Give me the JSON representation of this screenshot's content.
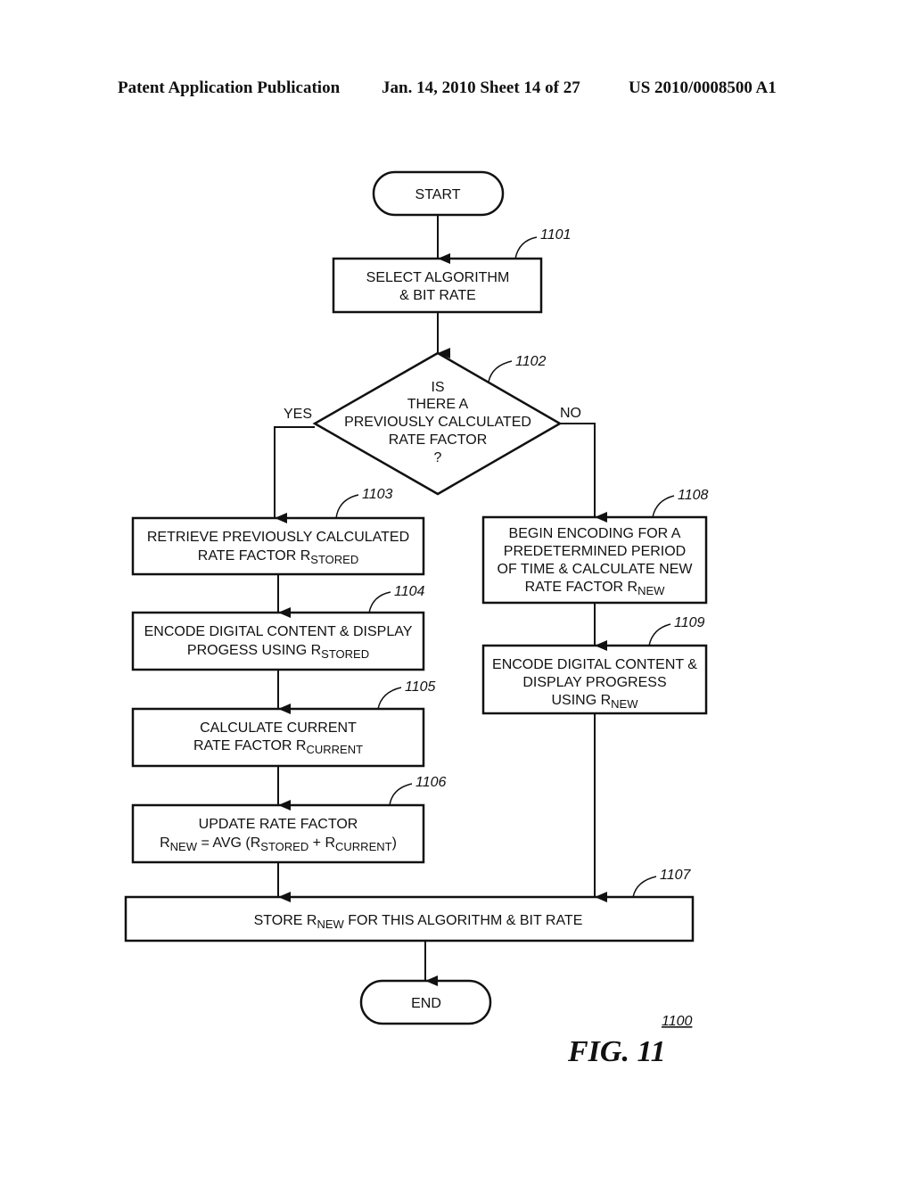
{
  "header": {
    "left": "Patent Application Publication",
    "middle": "Jan. 14, 2010  Sheet 14 of 27",
    "right": "US 2010/0008500 A1"
  },
  "figure": {
    "label": "FIG. 11",
    "ref": "1100"
  },
  "nodes": {
    "start": {
      "text": "START"
    },
    "n1101": {
      "ref": "1101",
      "lines": [
        "SELECT ALGORITHM",
        "& BIT RATE"
      ]
    },
    "n1102": {
      "ref": "1102",
      "lines": [
        "IS",
        "THERE A",
        "PREVIOUSLY CALCULATED",
        "RATE FACTOR",
        "?"
      ],
      "yes": "YES",
      "no": "NO"
    },
    "n1103": {
      "ref": "1103",
      "line1": "RETRIEVE PREVIOUSLY CALCULATED",
      "line2_main": "RATE FACTOR R",
      "line2_sub": "STORED"
    },
    "n1104": {
      "ref": "1104",
      "line1": "ENCODE DIGITAL CONTENT & DISPLAY",
      "line2_main": "PROGESS USING  R",
      "line2_sub": "STORED"
    },
    "n1105": {
      "ref": "1105",
      "line1": "CALCULATE CURRENT",
      "line2_main": "RATE FACTOR  R",
      "line2_sub": "CURRENT"
    },
    "n1106": {
      "ref": "1106",
      "line1": "UPDATE RATE FACTOR",
      "r": "R",
      "sub_new": "NEW",
      "eq": " = AVG (R",
      "sub_stored": "STORED",
      "plus": " + R",
      "sub_current": "CURRENT",
      "close": ")"
    },
    "n1108": {
      "ref": "1108",
      "lines": [
        "BEGIN ENCODING FOR A",
        "PREDETERMINED PERIOD",
        "OF TIME & CALCULATE NEW"
      ],
      "line4_main": "RATE FACTOR R",
      "line4_sub": "NEW"
    },
    "n1109": {
      "ref": "1109",
      "lines": [
        "ENCODE DIGITAL CONTENT &",
        "DISPLAY PROGRESS"
      ],
      "line3_main": "USING R",
      "line3_sub": "NEW"
    },
    "n1107": {
      "ref": "1107",
      "pre": "STORE R",
      "sub": "NEW",
      "post": " FOR THIS ALGORITHM & BIT RATE"
    },
    "end": {
      "text": "END"
    }
  }
}
